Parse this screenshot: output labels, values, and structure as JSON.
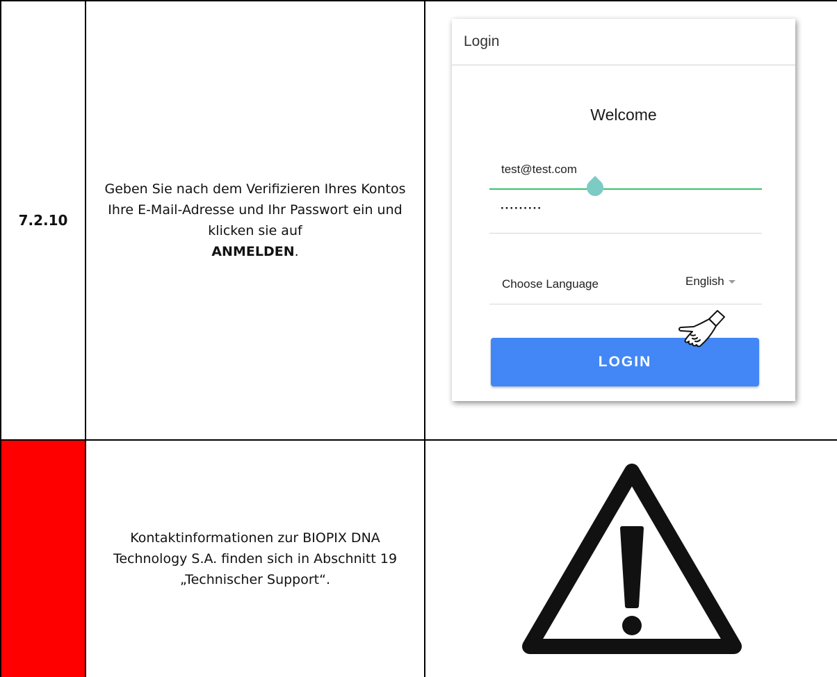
{
  "rows": [
    {
      "step": "7.2.10",
      "instruction_pre": "Geben Sie nach dem Verifizieren Ihres Kontos Ihre E-Mail-Adresse und Ihr Passwort ein und klicken sie auf",
      "instruction_bold": "ANMELDEN",
      "instruction_post": "."
    },
    {
      "step": "",
      "instruction": "Kontaktinformationen zur BIOPIX DNA Technology S.A. finden sich in Abschnitt 19 „Technischer Support“."
    }
  ],
  "login": {
    "header_title": "Login",
    "welcome": "Welcome",
    "email_value": "test@test.com",
    "password_value": "·········",
    "language_label": "Choose Language",
    "language_value": "English",
    "button_label": "LOGIN"
  },
  "colors": {
    "warning_cell": "#ff0000",
    "login_button": "#4287f5",
    "focus_underline": "#34c46a"
  },
  "icons": {
    "pointer": "pointing-hand-icon",
    "warning": "warning-triangle-icon"
  }
}
